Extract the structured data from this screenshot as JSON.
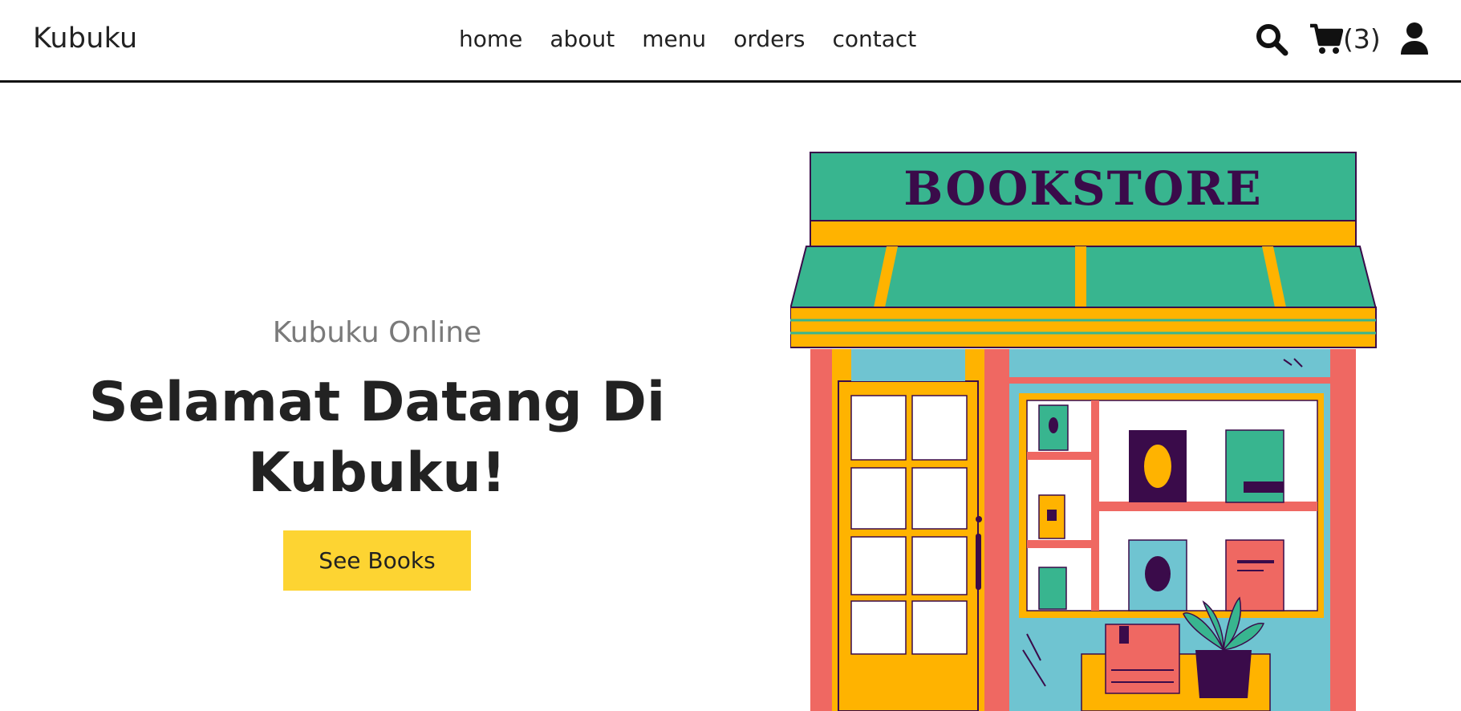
{
  "header": {
    "logo": "Kubuku",
    "nav": [
      "home",
      "about",
      "menu",
      "orders",
      "contact"
    ],
    "cart_count": "(3)",
    "icons": [
      "search-icon",
      "cart-icon",
      "user-icon"
    ]
  },
  "hero": {
    "subtitle": "Kubuku Online",
    "title": "Selamat Datang Di Kubuku!",
    "button": "See Books"
  },
  "illustration": {
    "sign_text": "BOOKSTORE"
  },
  "colors": {
    "accent": "#fdd432",
    "awning_green": "#38b58f",
    "trim_yellow": "#ffb300",
    "wall_red": "#ef6862",
    "window_blue": "#6fc4d1",
    "dark_purple": "#3a0b4a"
  }
}
